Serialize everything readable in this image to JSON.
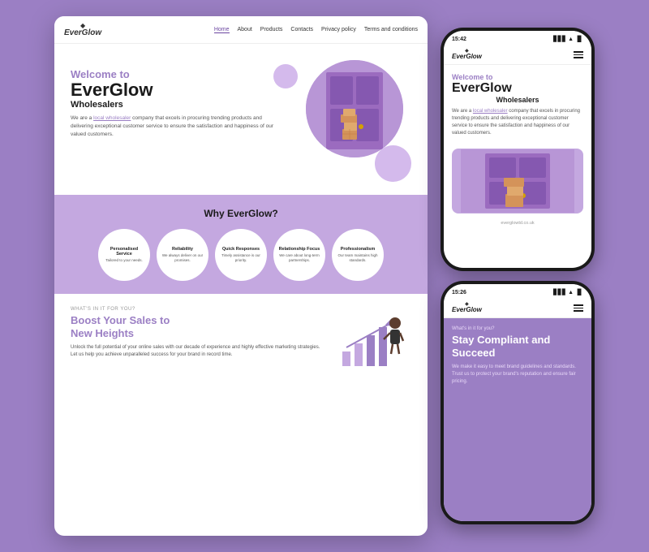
{
  "brand": {
    "name": "EverGlow",
    "diamond": "◆",
    "url": "everglowtd.co.uk"
  },
  "desktop": {
    "nav": {
      "items": [
        "Home",
        "About",
        "Products",
        "Contacts",
        "Privacy policy",
        "Terms and conditions"
      ],
      "active": "Home"
    },
    "hero": {
      "welcome": "Welcome to",
      "brand_name": "EverGlow",
      "subtitle": "Wholesalers",
      "desc_pre": "We are a ",
      "desc_link": "local wholesaler",
      "desc_post": " company that excels in procuring trending products and delivering exceptional customer service to ensure the satisfaction and happiness of our valued customers."
    },
    "why": {
      "heading": "Why EverGlow?",
      "circles": [
        {
          "title": "Personalised Service",
          "desc": "Tailored to your needs."
        },
        {
          "title": "Reliability",
          "desc": "We always deliver on our promises."
        },
        {
          "title": "Quick Responses",
          "desc": "Timely assistance is our priority."
        },
        {
          "title": "Relationship Focus",
          "desc": "We care about long-term partnerships."
        },
        {
          "title": "Professionalism",
          "desc": "Our team maintains high standards."
        }
      ]
    },
    "boost": {
      "label": "What's in it for you?",
      "heading_line1": "Boost Your Sales to",
      "heading_line2": "New Heights",
      "desc": "Unlock the full potential of your online sales with our decade of experience and highly effective marketing strategies. Let us help you achieve unparalleled success for your brand in record time."
    }
  },
  "phone1": {
    "time": "15:42",
    "hero": {
      "welcome": "Welcome to",
      "brand_name": "EverGlow",
      "subtitle": "Wholesalers",
      "desc_pre": "We are a ",
      "desc_link": "local wholesaler",
      "desc_post": " company that excels in procuring trending products and delivering exceptional customer service to ensure the satisfaction and happiness of our valued customers."
    }
  },
  "phone2": {
    "time": "15:26",
    "section": {
      "label": "What's in it for you?",
      "heading_line1": "Stay Compliant and",
      "heading_line2": "Succeed",
      "desc": "We make it easy to meet brand guidelines and standards. Trust us to protect your brand's reputation and ensure fair pricing."
    }
  }
}
